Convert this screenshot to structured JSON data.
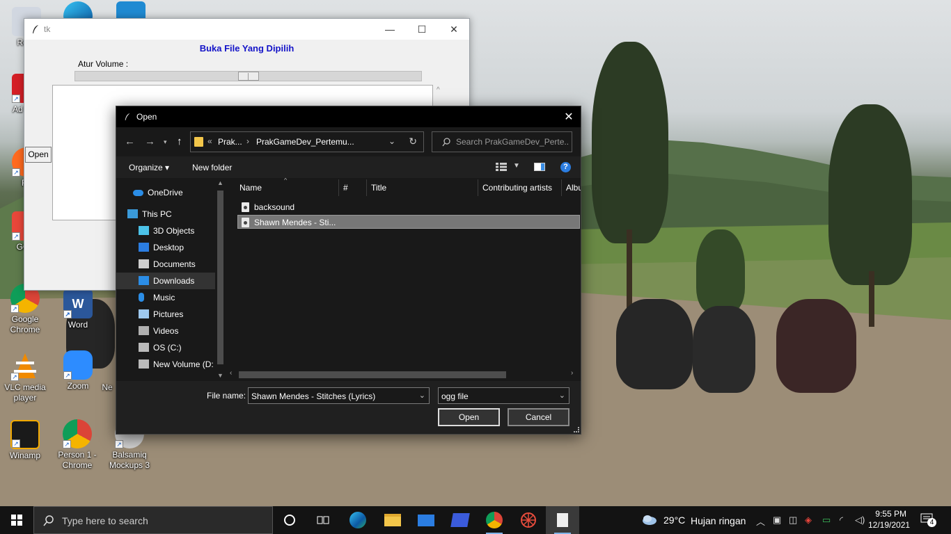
{
  "desktop": {
    "icons": [
      {
        "label": "Recy",
        "color": "#cfd6e0"
      },
      {
        "label": "Ad Rea",
        "color": "#d41f26"
      },
      {
        "label": "Fir",
        "color": "#ff6a1f"
      },
      {
        "label": "GOM",
        "color": "#e8473a"
      },
      {
        "label": "Google Chrome",
        "color": "#4285f4"
      },
      {
        "label": "Word",
        "color": "#2b579a"
      },
      {
        "label": "VLC media player",
        "color": "#f08a00"
      },
      {
        "label": "Zoom",
        "color": "#2d8cff"
      },
      {
        "label": "Ne",
        "color": "#888888"
      },
      {
        "label": "Winamp",
        "color": "#f2a900"
      },
      {
        "label": "Person 1 - Chrome",
        "color": "#4285f4"
      },
      {
        "label": "Balsamiq Mockups 3",
        "color": "#d0d0d0"
      }
    ]
  },
  "tk_window": {
    "title": "tk",
    "heading": "Buka File Yang Dipilih",
    "volume_label": "Atur Volume :",
    "volume_value": 0.5,
    "open_button": "Open",
    "controls": {
      "minimize": "—",
      "maximize": "☐",
      "close": "✕"
    }
  },
  "dialog": {
    "title": "Open",
    "close": "✕",
    "address": {
      "overflow": "«",
      "segments": [
        "Prak...",
        "PrakGameDev_Pertemu..."
      ],
      "separator": "›"
    },
    "search_placeholder": "Search PrakGameDev_Perte...",
    "toolbar": {
      "organize": "Organize ▾",
      "new_folder": "New folder"
    },
    "nav_items": [
      {
        "label": "OneDrive",
        "icon": "onedrive-icon"
      },
      {
        "label": "This PC",
        "icon": "pc-icon"
      },
      {
        "label": "3D Objects",
        "icon": "cube-icon"
      },
      {
        "label": "Desktop",
        "icon": "desktop-icon"
      },
      {
        "label": "Documents",
        "icon": "documents-icon"
      },
      {
        "label": "Downloads",
        "icon": "download-icon"
      },
      {
        "label": "Music",
        "icon": "music-icon"
      },
      {
        "label": "Pictures",
        "icon": "pictures-icon"
      },
      {
        "label": "Videos",
        "icon": "videos-icon"
      },
      {
        "label": "OS (C:)",
        "icon": "drive-icon"
      },
      {
        "label": "New Volume (D:",
        "icon": "drive-icon"
      }
    ],
    "selected_nav": "Downloads",
    "columns": [
      "Name",
      "#",
      "Title",
      "Contributing artists",
      "Albu"
    ],
    "files": [
      {
        "name": "backsound",
        "selected": false
      },
      {
        "name": "Shawn Mendes - Sti...",
        "selected": true
      }
    ],
    "file_name_label": "File name:",
    "file_name_value": "Shawn Mendes - Stitches (Lyrics)",
    "file_type_value": "ogg file",
    "open_button": "Open",
    "cancel_button": "Cancel"
  },
  "taskbar": {
    "search_placeholder": "Type here to search",
    "weather_temp": "29°C",
    "weather_desc": "Hujan ringan",
    "clock_time": "9:55 PM",
    "clock_date": "12/19/2021",
    "notification_count": "4"
  }
}
